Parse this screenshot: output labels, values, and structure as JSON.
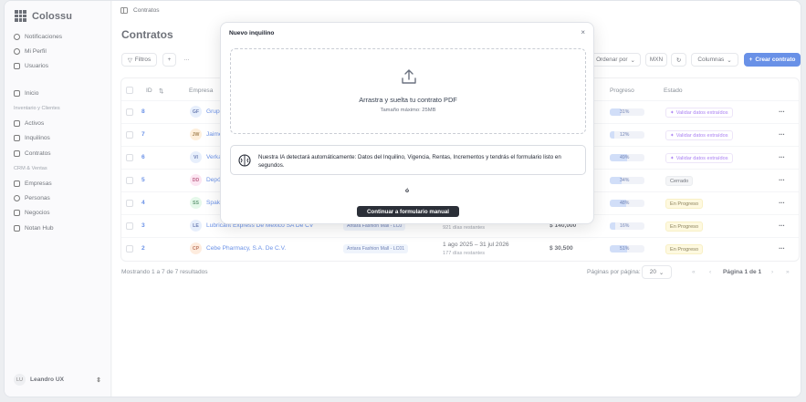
{
  "app": {
    "name": "Colossu"
  },
  "sidebar": {
    "items_top": [
      {
        "label": "Notificaciones",
        "icon": "bell-icon"
      },
      {
        "label": "Mi Perfil",
        "icon": "user-circle-icon"
      },
      {
        "label": "Usuarios",
        "icon": "users-icon"
      }
    ],
    "inicio": "Inicio",
    "section_inventario": "Inventario y Clientes",
    "items_inventario": [
      {
        "label": "Activos",
        "icon": "box-icon"
      },
      {
        "label": "Inquilinos",
        "icon": "people-icon"
      },
      {
        "label": "Contratos",
        "icon": "document-icon"
      }
    ],
    "section_crm": "CRM & Ventas",
    "items_crm": [
      {
        "label": "Empresas",
        "icon": "building-icon"
      },
      {
        "label": "Personas",
        "icon": "person-icon"
      },
      {
        "label": "Negocios",
        "icon": "briefcase-icon"
      },
      {
        "label": "Notan Hub",
        "icon": "hub-icon"
      }
    ],
    "user": {
      "initials": "LU",
      "name": "Leandro UX"
    }
  },
  "topbar": {
    "breadcrumb": "Contratos"
  },
  "page": {
    "title": "Contratos"
  },
  "toolbar": {
    "filters": "Filtros",
    "add": "+",
    "more": "···",
    "sort": "Ordenar por",
    "currency": "MXN",
    "columns": "Columnas",
    "create": "Crear contrato"
  },
  "table": {
    "headers": {
      "id": "ID",
      "empresa": "Empresa",
      "progreso": "Progreso",
      "estado": "Estado"
    },
    "rows": [
      {
        "id": "8",
        "initials": "GF",
        "company": "Grupo",
        "color": "#dbe6fb",
        "loc": "",
        "dates": "",
        "remaining": "",
        "amount": "",
        "progress": "31%",
        "status": "Validar datos extraídos",
        "kind": "validar"
      },
      {
        "id": "7",
        "initials": "JW",
        "company": "Jaime",
        "color": "#fde7c8",
        "loc": "",
        "dates": "",
        "remaining": "",
        "amount": "",
        "progress": "12%",
        "status": "Validar datos extraídos",
        "kind": "validar"
      },
      {
        "id": "6",
        "initials": "VI",
        "company": "Verka",
        "color": "#dbe6fb",
        "loc": "",
        "dates": "",
        "remaining": "",
        "amount": "",
        "progress": "49%",
        "status": "Validar datos extraídos",
        "kind": "validar"
      },
      {
        "id": "5",
        "initials": "DD",
        "company": "Depó",
        "color": "#fbd9ec",
        "loc": "",
        "dates": "",
        "remaining": "",
        "amount": "",
        "progress": "34%",
        "status": "Cerrado",
        "kind": "cerrado"
      },
      {
        "id": "4",
        "initials": "SS",
        "company": "Spaki",
        "color": "#d7f5df",
        "loc": "",
        "dates": "",
        "remaining": "",
        "amount": "",
        "progress": "48%",
        "status": "En Progreso",
        "kind": "progreso"
      },
      {
        "id": "3",
        "initials": "LE",
        "company": "Lubricant Express De Mexico SA De CV",
        "color": "#dbe6fb",
        "loc": "Antara Fashion Mall - LC0",
        "dates": "",
        "remaining": "921 días restantes",
        "amount": "$ 140,000",
        "progress": "16%",
        "status": "En Progreso",
        "kind": "progreso"
      },
      {
        "id": "2",
        "initials": "CP",
        "company": "Cebe Pharmacy, S.A. De C.V.",
        "color": "#fde2cc",
        "loc": "Antara Fashion Mall - LC01",
        "dates": "1 ago 2025 – 31 jul 2026",
        "remaining": "177 días restantes",
        "amount": "$ 30,500",
        "progress": "51%",
        "status": "En Progreso",
        "kind": "progreso"
      }
    ]
  },
  "footer": {
    "showing": "Mostrando 1 a 7 de 7 resultados",
    "per_page_label": "Páginas por página:",
    "per_page": "20",
    "page_info": "Página 1 de 1"
  },
  "modal": {
    "title": "Nuevo inquilino",
    "close": "×",
    "drop_main": "Arrastra y suelta tu contrato PDF",
    "drop_sub": "Tamaño máximo: 25MB",
    "ai_text": "Nuestra IA detectará automáticamente: Datos del Inquilino, Vigencia, Rentas, Incrementos y tendrás el formulario listo en segundos.",
    "or": "ó",
    "manual_button": "Continuar a formulario manual"
  },
  "colors": {
    "accent": "#1a56db",
    "validar": "#7c3aed",
    "progreso_bg": "#fdf6cf",
    "dark_button": "#2b2f38"
  }
}
